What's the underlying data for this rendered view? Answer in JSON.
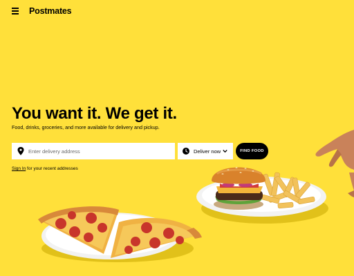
{
  "header": {
    "menu_icon": "hamburger-menu-icon",
    "brand": "Postmates"
  },
  "hero": {
    "title": "You want it. We get it.",
    "subtitle": "Food, drinks, groceries, and more available for delivery and pickup."
  },
  "search": {
    "address_icon": "location-pin-icon",
    "address_placeholder": "Enter delivery address",
    "address_value": "",
    "time_icon": "clock-icon",
    "time_selected": "Deliver now",
    "time_chevron_icon": "chevron-down-icon",
    "submit_label": "FIND FOOD"
  },
  "signin": {
    "link_label": "Sign In",
    "suffix": " for your recent addresses"
  },
  "illustrations": [
    "pizza-plate",
    "burger-fries-plate",
    "hand"
  ],
  "colors": {
    "background": "#FFE03A",
    "button": "#000000",
    "button_text": "#FFFFFF",
    "field_background": "#FFFFFF"
  }
}
